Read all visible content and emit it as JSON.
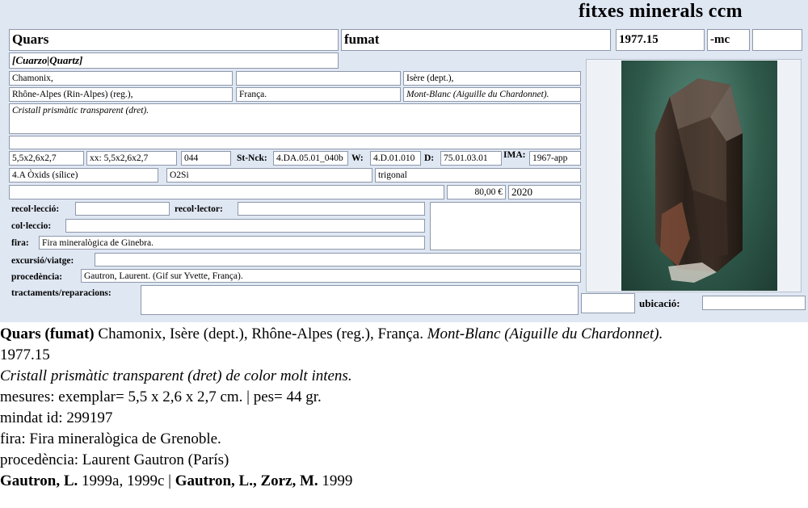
{
  "brand": "fitxes minerals ccm",
  "card": {
    "name": "Quars",
    "variety": "fumat",
    "catalog_number": "1977.15",
    "suffix": "-mc",
    "extra": "",
    "synonyms": "[Cuarzo|Quartz]",
    "locality": "Chamonix,",
    "locality_2": "",
    "department": "Isère (dept.),",
    "region": "Rhône-Alpes (Rin-Alpes) (reg.),",
    "country": "França.",
    "site": "Mont-Blanc (Aiguille du Chardonnet).",
    "description": "Cristall prismàtic transparent (dret).",
    "description_2": "",
    "dimensions": "5,5x2,6x2,7",
    "crystal_dims": "xx: 5,5x2,6x2,7",
    "weight": "044",
    "st_nck_label": "St-Nck:",
    "st_nck": "4.DA.05.01_040b",
    "w_label": "W:",
    "w_value": "4.D.01.010",
    "d_label": "D:",
    "d_value": "75.01.03.01",
    "ima_label": "IMA:",
    "ima": "1967-app",
    "class": "4.A Òxids (sílice)",
    "formula": "O2Si",
    "system": "trigonal",
    "price": "80,00 €",
    "year": "2020",
    "recoleccio_label": "recol·lecció:",
    "recoleccio": "",
    "recollector_label": "recol·lector:",
    "recollector": "",
    "colleccio_label": "col·leccio:",
    "colleccio": "",
    "fira_label": "fira:",
    "fira": "Fira mineralògica de Ginebra.",
    "excursio_label": "excursió/viatge:",
    "excursio": "",
    "procedencia_label": "procedència:",
    "procedencia": "Gautron, Laurent. (Gif sur Yvette, França).",
    "tractaments_label": "tractaments/reparacions:",
    "tractaments": "",
    "ubicacio_label": "ubicació:",
    "ubicacio": "",
    "box_code": ""
  },
  "summary": {
    "name": "Quars (fumat)",
    "locality_text": " Chamonix, Isère (dept.), Rhône-Alpes (reg.), França. ",
    "site_text": "Mont-Blanc (Aiguille du Chardonnet).",
    "catalog": "1977.15",
    "description": "Cristall prismàtic transparent (dret) de color molt intens.",
    "measures": "mesures: exemplar= 5,5 x 2,6 x 2,7 cm. | pes= 44 gr.",
    "mindat": "mindat id: 299197",
    "fira": "fira: Fira mineralògica de Grenoble.",
    "procedencia": "procedència: Laurent Gautron (París)",
    "ref_author_1": "Gautron, L.",
    "ref_years_1": " 1999a, 1999c | ",
    "ref_author_2": "Gautron, L., Zorz, M.",
    "ref_years_2": " 1999"
  },
  "colors": {
    "card_bg": "#dfe7f3",
    "field_border": "#8e98aa",
    "photo_bg": "#2f5a4b"
  },
  "icons": {
    "photo": "smoky-quartz-crystal-photo"
  }
}
